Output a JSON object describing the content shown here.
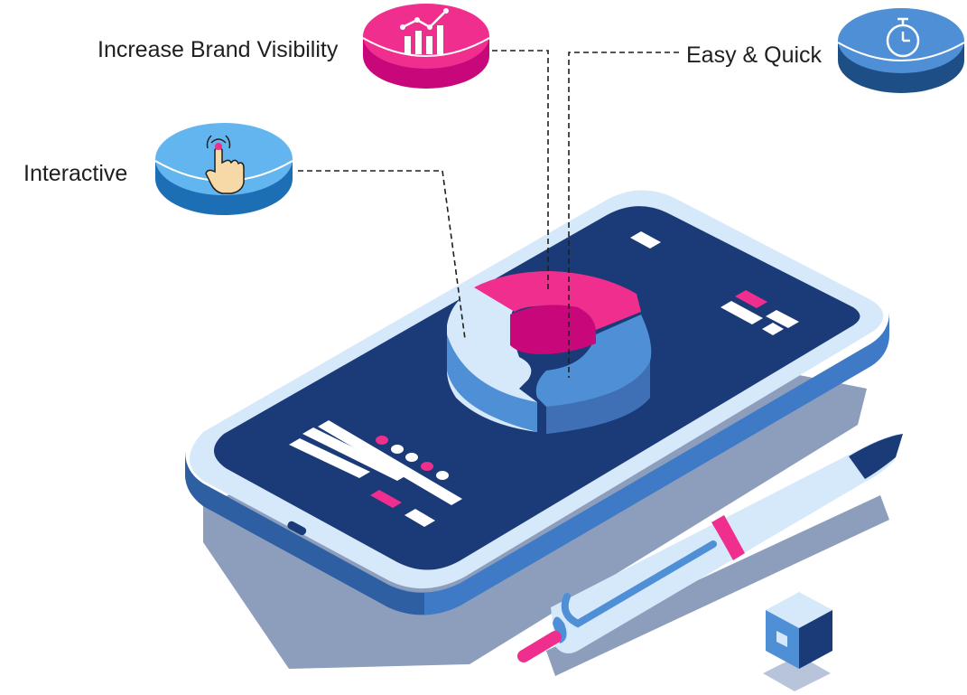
{
  "features": [
    {
      "label": "Increase Brand Visibility",
      "icon": "bar-chart-growth-icon",
      "color": "#f02e8d"
    },
    {
      "label": "Easy & Quick",
      "icon": "stopwatch-icon",
      "color": "#4f8fd6"
    },
    {
      "label": "Interactive",
      "icon": "touch-hand-icon",
      "color": "#63b5f0"
    }
  ],
  "colors": {
    "navy": "#1b3a78",
    "phone_body": "#d6e9fb",
    "phone_side": "#3f7ac6",
    "shadow": "#8d9ebd",
    "magenta": "#f02e8d",
    "dark_magenta": "#c8087a",
    "light_blue": "#d6e9fb",
    "mid_blue": "#4f8fd6",
    "dark_blue": "#2f66b0"
  }
}
